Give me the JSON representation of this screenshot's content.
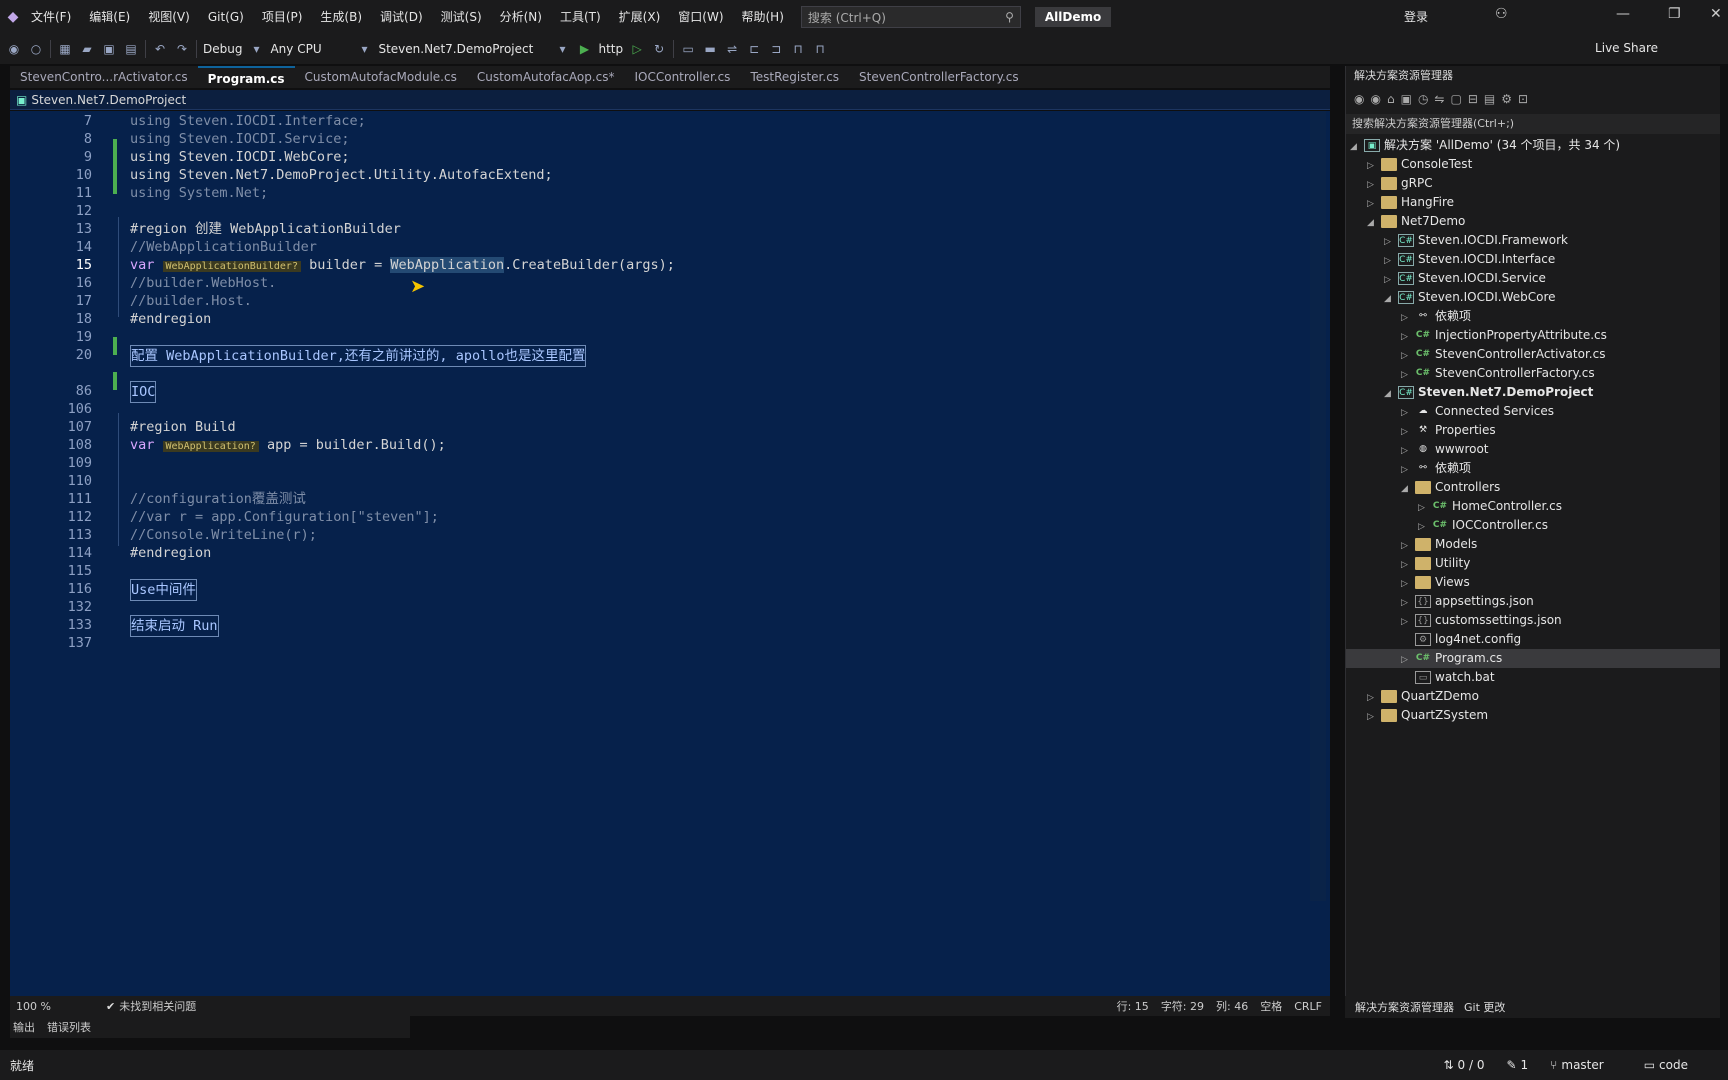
{
  "menubar": {
    "items": [
      "文件(F)",
      "编辑(E)",
      "视图(V)",
      "Git(G)",
      "项目(P)",
      "生成(B)",
      "调试(D)",
      "测试(S)",
      "分析(N)",
      "工具(T)",
      "扩展(X)",
      "窗口(W)",
      "帮助(H)"
    ],
    "search_placeholder": "搜索 (Ctrl+Q)",
    "solution_badge": "AllDemo",
    "login": "登录"
  },
  "toolbar": {
    "config": "Debug",
    "platform": "Any CPU",
    "startup_project": "Steven.Net7.DemoProject",
    "run_target": "http",
    "live_share": "Live Share"
  },
  "tabs": [
    {
      "label": "StevenContro...rActivator.cs"
    },
    {
      "label": "Program.cs"
    },
    {
      "label": "CustomAutofacModule.cs"
    },
    {
      "label": "CustomAutofacAop.cs*"
    },
    {
      "label": "IOCController.cs"
    },
    {
      "label": "TestRegister.cs"
    },
    {
      "label": "StevenControllerFactory.cs"
    }
  ],
  "navbar": {
    "project": "Steven.Net7.DemoProject"
  },
  "code_lines": [
    {
      "num": "7",
      "text": "using Steven.IOCDI.Interface;"
    },
    {
      "num": "8",
      "text": "using Steven.IOCDI.Service;"
    },
    {
      "num": "9",
      "text": "using Steven.IOCDI.WebCore;"
    },
    {
      "num": "10",
      "text": "using Steven.Net7.DemoProject.Utility.AutofacExtend;"
    },
    {
      "num": "11",
      "text": "using System.Net;"
    },
    {
      "num": "12",
      "text": ""
    },
    {
      "num": "13",
      "text": "#region 创建 WebApplicationBuilder"
    },
    {
      "num": "14",
      "text": "//WebApplicationBuilder"
    },
    {
      "num": "15",
      "text_a": "var ",
      "hint": "WebApplicationBuilder?",
      "text_b": " builder = ",
      "hl": "WebApplication",
      "text_c": ".CreateBuilder(args);"
    },
    {
      "num": "16",
      "text": "//builder.WebHost."
    },
    {
      "num": "17",
      "text": "//builder.Host."
    },
    {
      "num": "18",
      "text": "#endregion"
    },
    {
      "num": "19",
      "text": ""
    },
    {
      "num": "20",
      "text": "配置 WebApplicationBuilder,还有之前讲过的, apollo也是这里配置"
    },
    {
      "num": "86",
      "text": "IOC"
    },
    {
      "num": "106",
      "text": ""
    },
    {
      "num": "107",
      "text": "#region Build"
    },
    {
      "num": "108",
      "text_a": "var ",
      "hint": "WebApplication?",
      "text_b": " app = builder.Build();"
    },
    {
      "num": "109",
      "text": ""
    },
    {
      "num": "110",
      "text": ""
    },
    {
      "num": "111",
      "text": "//configuration覆盖测试"
    },
    {
      "num": "112",
      "text": "//var r = app.Configuration[\"steven\"];"
    },
    {
      "num": "113",
      "text": "//Console.WriteLine(r);"
    },
    {
      "num": "114",
      "text": "#endregion"
    },
    {
      "num": "115",
      "text": ""
    },
    {
      "num": "116",
      "text": "Use中间件"
    },
    {
      "num": "132",
      "text": ""
    },
    {
      "num": "133",
      "text": "结束启动 Run"
    },
    {
      "num": "137",
      "text": ""
    }
  ],
  "editor_status": {
    "zoom": "100 %",
    "issues": "未找到相关问题",
    "line": "行: 15",
    "char": "字符: 29",
    "col": "列: 46",
    "spaces": "空格",
    "eol": "CRLF"
  },
  "bottom_tabs": [
    "输出",
    "错误列表"
  ],
  "status": {
    "ready": "就绪",
    "changes": "0 / 0",
    "edits": "1",
    "branch": "master",
    "repo": "code"
  },
  "solution_explorer": {
    "title": "解决方案资源管理器",
    "search": "搜索解决方案资源管理器(Ctrl+;)",
    "items": [
      {
        "label": "解决方案 'AllDemo' (34 个项目，共 34 个)",
        "indent": 0,
        "icon": "solution",
        "expand": "open"
      },
      {
        "label": "ConsoleTest",
        "indent": 1,
        "icon": "folder",
        "expand": "closed"
      },
      {
        "label": "gRPC",
        "indent": 1,
        "icon": "folder",
        "expand": "closed"
      },
      {
        "label": "HangFire",
        "indent": 1,
        "icon": "folder",
        "expand": "closed"
      },
      {
        "label": "Net7Demo",
        "indent": 1,
        "icon": "folder",
        "expand": "open"
      },
      {
        "label": "Steven.IOCDI.Framework",
        "indent": 2,
        "icon": "proj",
        "expand": "closed"
      },
      {
        "label": "Steven.IOCDI.Interface",
        "indent": 2,
        "icon": "proj",
        "expand": "closed"
      },
      {
        "label": "Steven.IOCDI.Service",
        "indent": 2,
        "icon": "proj",
        "expand": "closed"
      },
      {
        "label": "Steven.IOCDI.WebCore",
        "indent": 2,
        "icon": "proj",
        "expand": "open"
      },
      {
        "label": "依赖项",
        "indent": 3,
        "icon": "deps",
        "expand": "closed"
      },
      {
        "label": "InjectionPropertyAttribute.cs",
        "indent": 3,
        "icon": "cs",
        "expand": "closed"
      },
      {
        "label": "StevenControllerActivator.cs",
        "indent": 3,
        "icon": "cs",
        "expand": "closed"
      },
      {
        "label": "StevenControllerFactory.cs",
        "indent": 3,
        "icon": "cs",
        "expand": "closed"
      },
      {
        "label": "Steven.Net7.DemoProject",
        "indent": 2,
        "icon": "proj",
        "expand": "open",
        "bold": true
      },
      {
        "label": "Connected Services",
        "indent": 3,
        "icon": "svc",
        "expand": "closed"
      },
      {
        "label": "Properties",
        "indent": 3,
        "icon": "props",
        "expand": "closed"
      },
      {
        "label": "wwwroot",
        "indent": 3,
        "icon": "globe",
        "expand": "closed"
      },
      {
        "label": "依赖项",
        "indent": 3,
        "icon": "deps",
        "expand": "closed"
      },
      {
        "label": "Controllers",
        "indent": 3,
        "icon": "folder",
        "expand": "open"
      },
      {
        "label": "HomeController.cs",
        "indent": 4,
        "icon": "cs",
        "expand": "closed"
      },
      {
        "label": "IOCController.cs",
        "indent": 4,
        "icon": "cs",
        "expand": "closed"
      },
      {
        "label": "Models",
        "indent": 3,
        "icon": "folder",
        "expand": "closed"
      },
      {
        "label": "Utility",
        "indent": 3,
        "icon": "folder",
        "expand": "closed"
      },
      {
        "label": "Views",
        "indent": 3,
        "icon": "folder",
        "expand": "closed"
      },
      {
        "label": "appsettings.json",
        "indent": 3,
        "icon": "json",
        "expand": "closed"
      },
      {
        "label": "customssettings.json",
        "indent": 3,
        "icon": "json",
        "expand": "closed"
      },
      {
        "label": "log4net.config",
        "indent": 3,
        "icon": "config",
        "expand": "none"
      },
      {
        "label": "Program.cs",
        "indent": 3,
        "icon": "cs",
        "expand": "closed",
        "selected": true
      },
      {
        "label": "watch.bat",
        "indent": 3,
        "icon": "file",
        "expand": "none"
      },
      {
        "label": "QuartZDemo",
        "indent": 1,
        "icon": "folder",
        "expand": "closed"
      },
      {
        "label": "QuartZSystem",
        "indent": 1,
        "icon": "folder",
        "expand": "closed"
      }
    ],
    "bottom_tabs": [
      "解决方案资源管理器",
      "Git 更改"
    ]
  }
}
